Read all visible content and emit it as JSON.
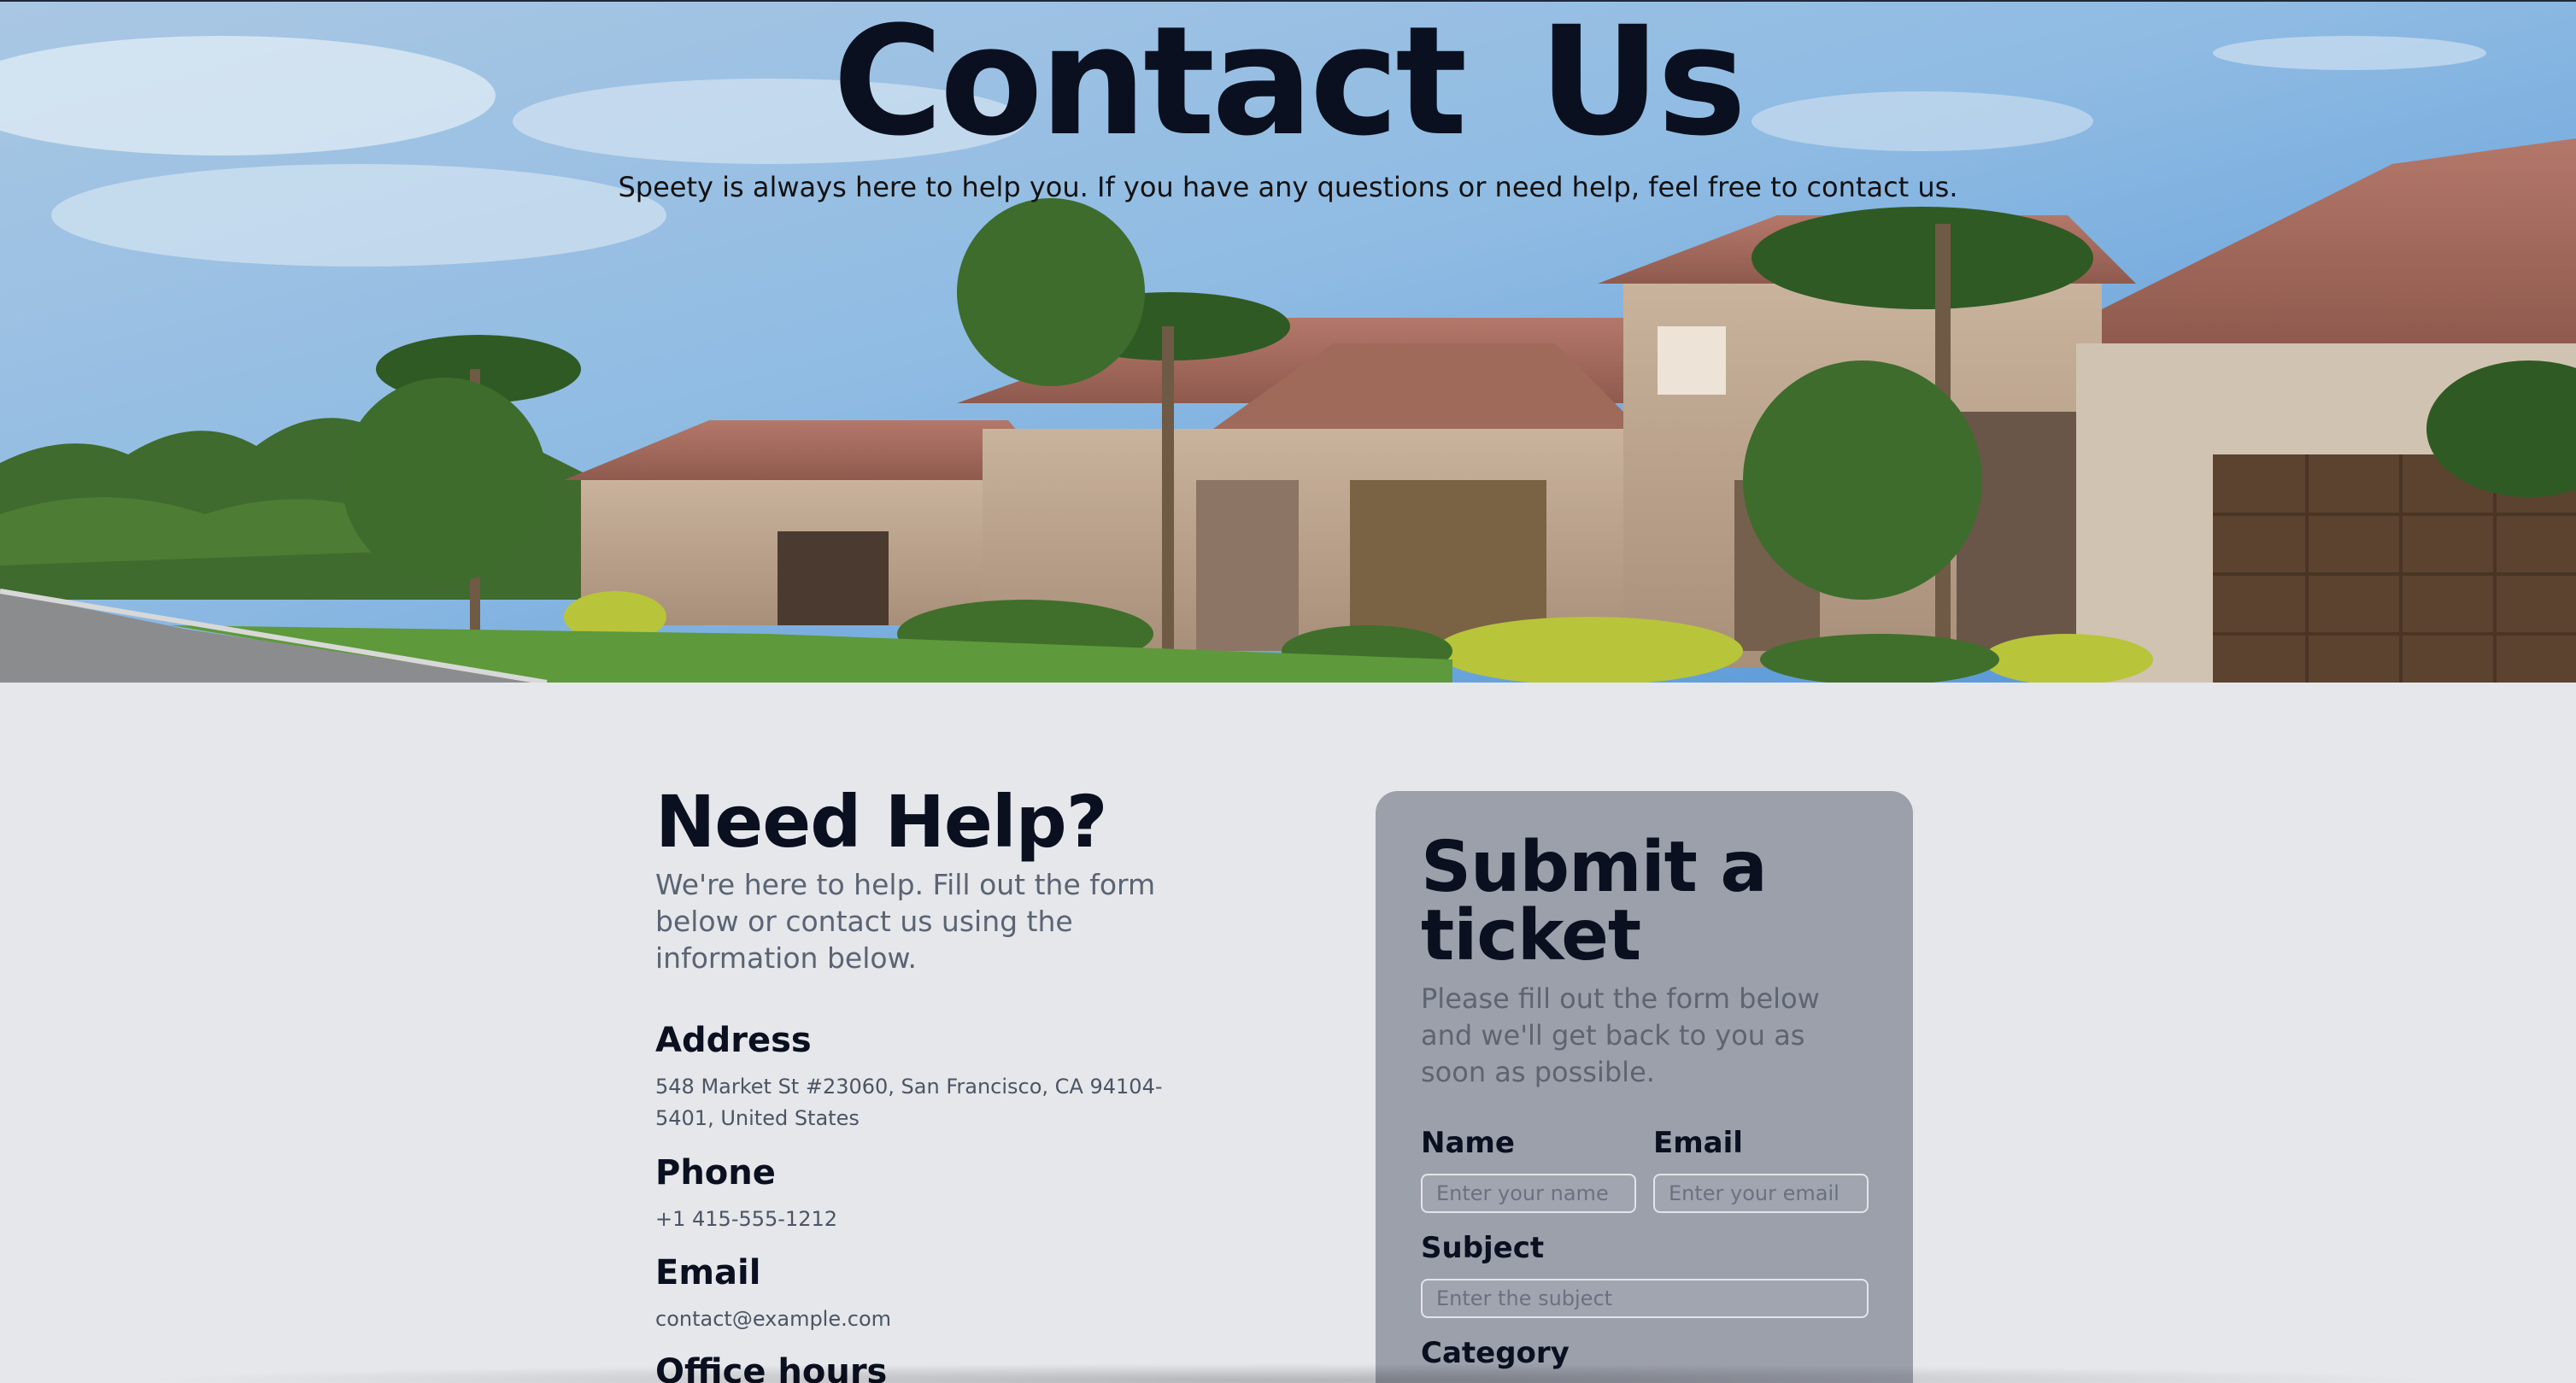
{
  "hero": {
    "title": "Contact Us",
    "subtitle": "Speety is always here to help you. If you have any questions or need help, feel free to contact us."
  },
  "help": {
    "heading": "Need Help?",
    "description": "We're here to help. Fill out the form below or contact us using the information below.",
    "address_label": "Address",
    "address_value": "548 Market St #23060, San Francisco, CA 94104-5401, United States",
    "phone_label": "Phone",
    "phone_value": "+1 415-555-1212",
    "email_label": "Email",
    "email_value": "contact@example.com",
    "hours_label": "Office hours"
  },
  "ticket": {
    "heading": "Submit a ticket",
    "description": "Please fill out the form below and we'll get back to you as soon as possible.",
    "name_label": "Name",
    "name_placeholder": "Enter your name",
    "email_label": "Email",
    "email_placeholder": "Enter your email",
    "subject_label": "Subject",
    "subject_placeholder": "Enter the subject",
    "category_label": "Category"
  },
  "colors": {
    "page_background": "#e5e7eb",
    "card_background": "#9ca0ab",
    "heading": "#0b1020",
    "muted_text": "#5b6473"
  },
  "icons": {
    "hero_image": "suburban-houses-with-palm-trees-photo"
  }
}
